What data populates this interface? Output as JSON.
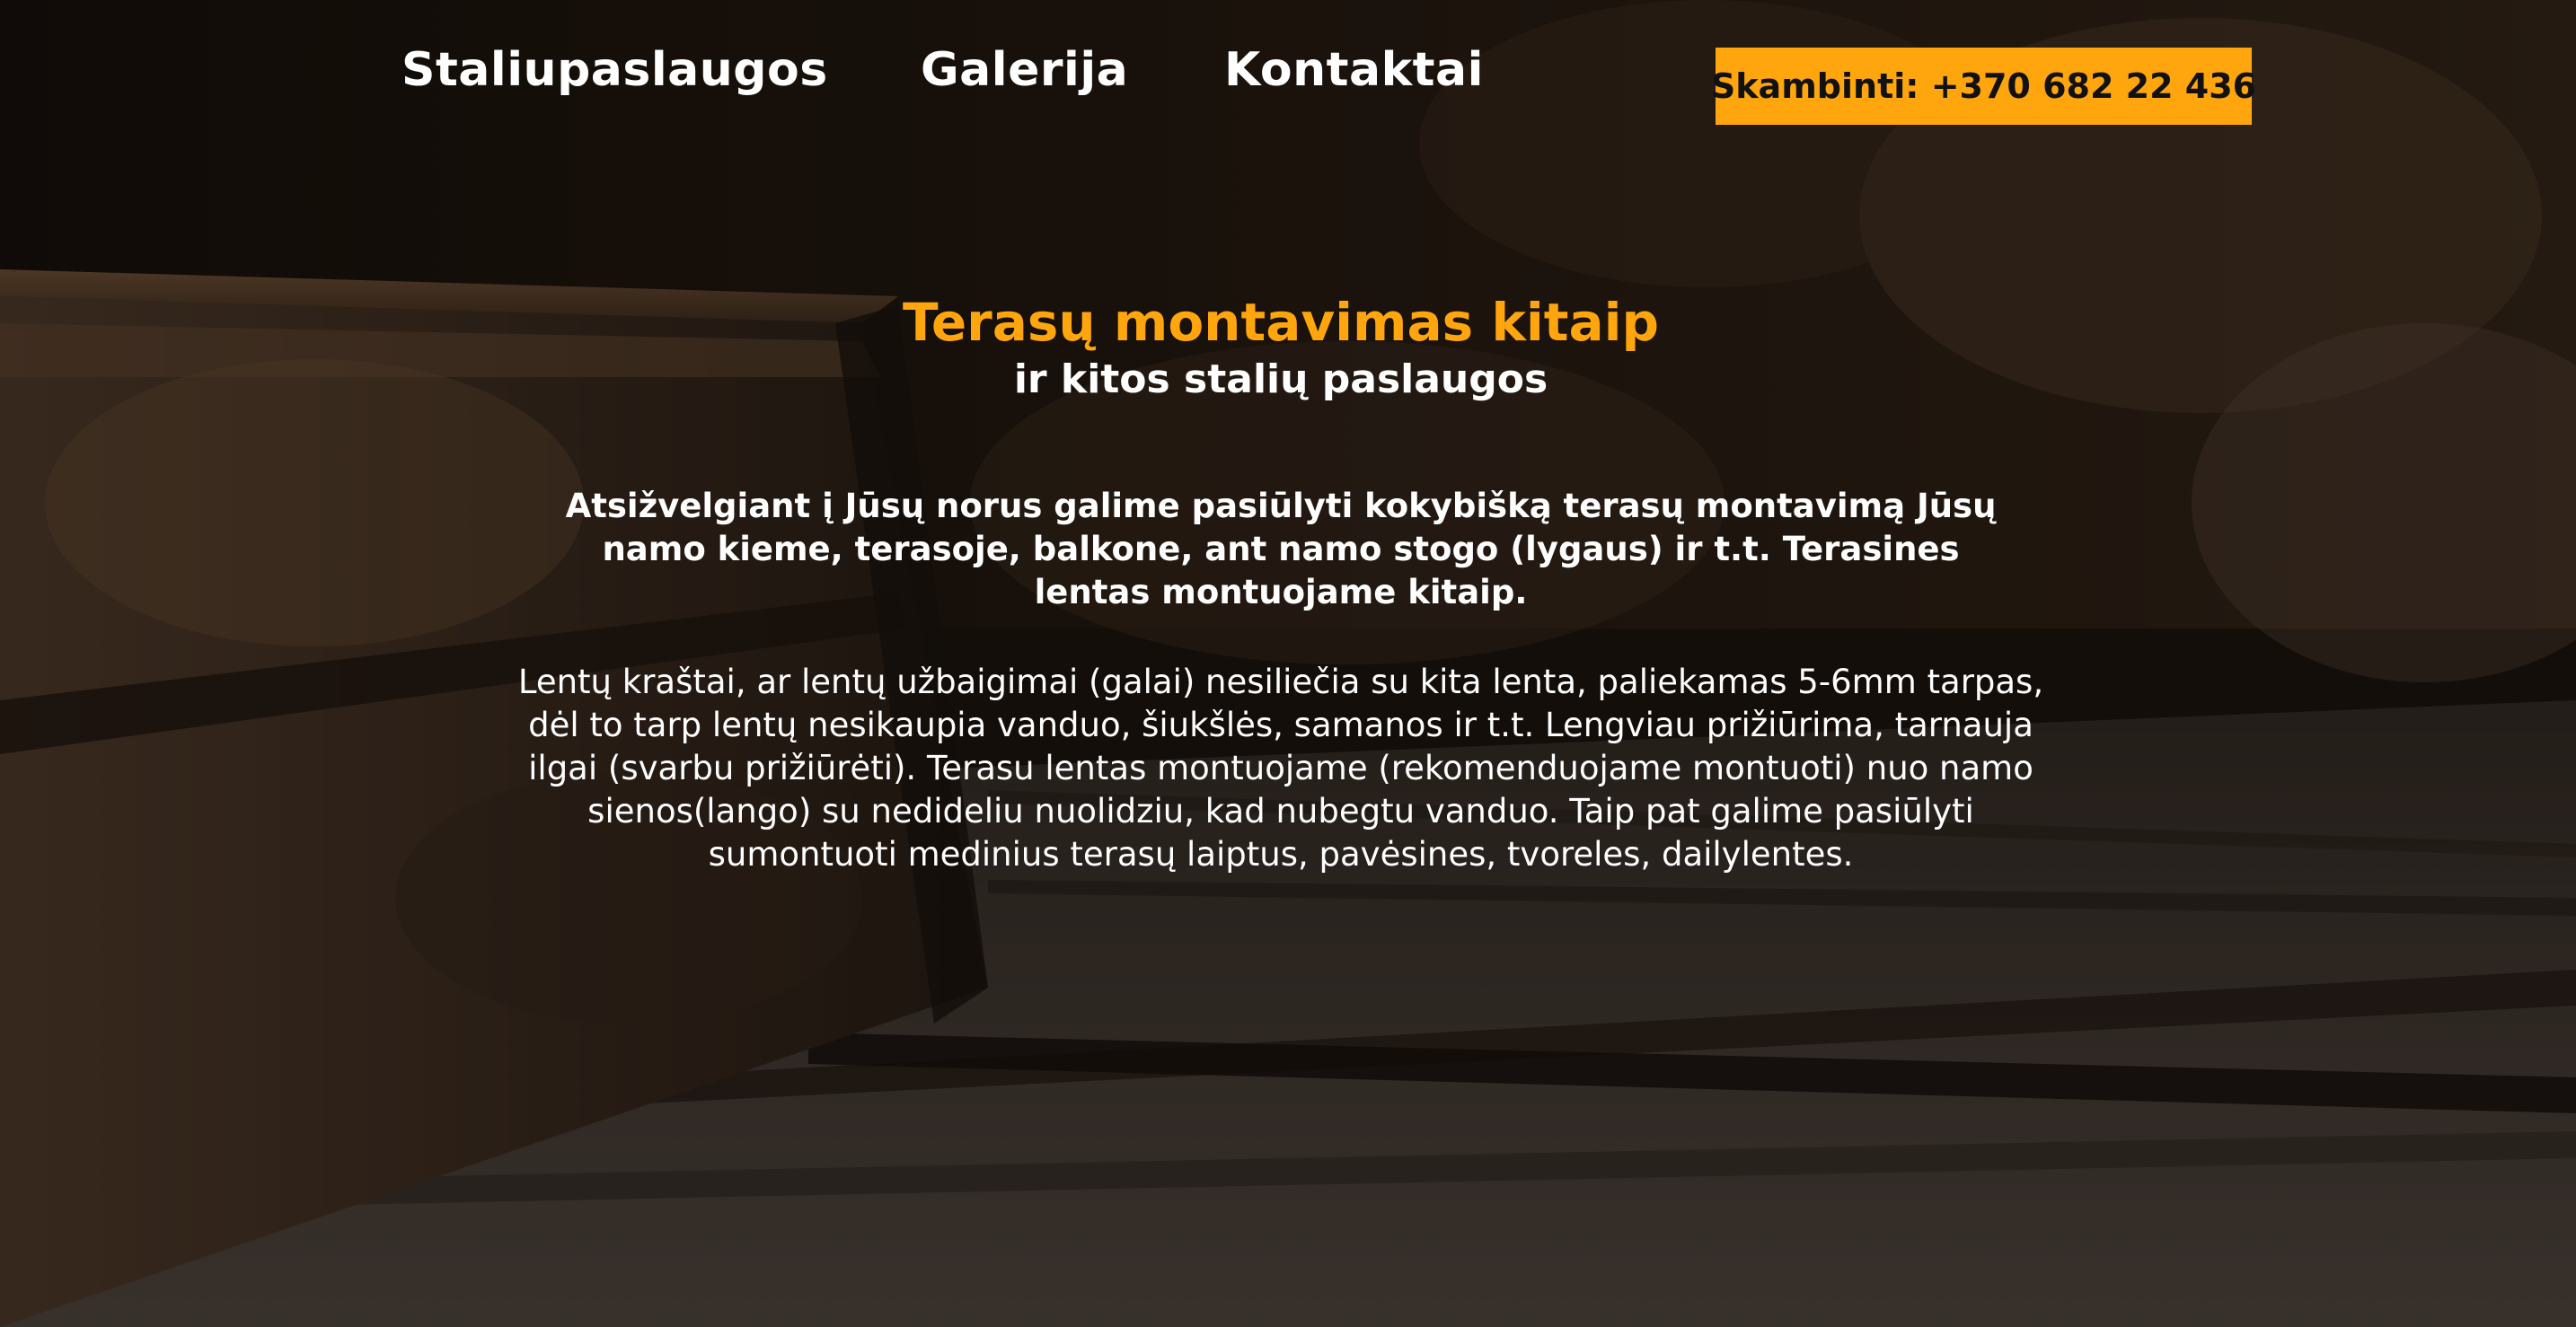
{
  "nav": {
    "items": [
      {
        "label": "Staliupaslaugos"
      },
      {
        "label": "Galerija"
      },
      {
        "label": "Kontaktai"
      }
    ],
    "call_button_label": "Skambinti: +370 682 22 436"
  },
  "hero": {
    "title": "Terasų montavimas kitaip",
    "subtitle": "ir kitos stalių paslaugos",
    "lead": "Atsižvelgiant į Jūsų norus galime pasiūlyti kokybišką terasų montavimą Jūsų namo kieme, terasoje, balkone, ant namo stogo (lygaus) ir t.t. Terasines lentas montuojame kitaip.",
    "body": "Lentų kraštai, ar lentų užbaigimai (galai) nesiliečia su kita lenta, paliekamas 5-6mm tarpas, dėl to tarp lentų nesikaupia vanduo, šiukšlės, samanos ir t.t. Lengviau prižiūrima, tarnauja ilgai (svarbu prižiūrėti). Terasu lentas montuojame (rekomenduojame montuoti) nuo namo sienos(lango) su nedideliu nuolidziu, kad nubegtu vanduo. Taip pat galime pasiūlyti sumontuoti medinius terasų laiptus, pavėsines, tvoreles, dailylentes."
  },
  "colors": {
    "accent": "#ffa50d",
    "text": "#ffffff",
    "button_text": "#111111"
  }
}
